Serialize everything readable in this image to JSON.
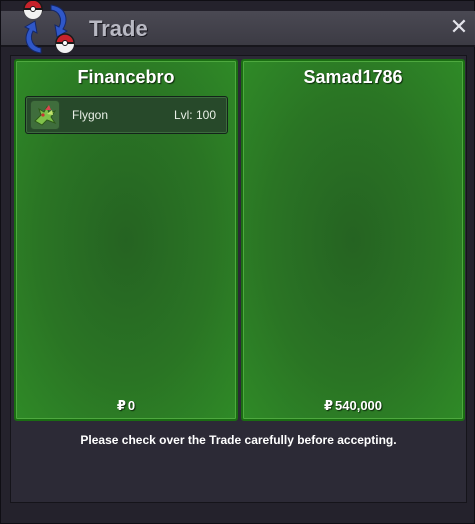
{
  "window": {
    "title": "Trade",
    "close_icon": "close-icon",
    "logo_icon": "trade-swap-icon"
  },
  "left_panel": {
    "player_name": "Financebro",
    "items": [
      {
        "name": "Flygon",
        "level": "Lvl: 100",
        "icon": "flygon-sprite-icon"
      }
    ],
    "currency_symbol": "₽",
    "money": "0"
  },
  "right_panel": {
    "player_name": "Samad1786",
    "items": [],
    "currency_symbol": "₽",
    "money": "540,000"
  },
  "footer": {
    "notice": "Please check over the Trade carefully before accepting."
  },
  "colors": {
    "panel_green": "#2a7424",
    "panel_border": "#1a6e12",
    "window_bg": "#24222c",
    "titlebar": "#4a4953"
  }
}
